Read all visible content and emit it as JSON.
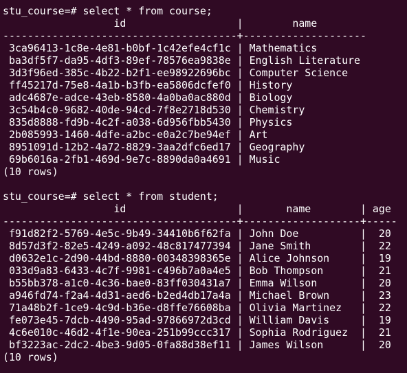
{
  "terminal": {
    "lines": [
      "stu_course=# select * from course;",
      "                  id                  |        name",
      "--------------------------------------+--------------------",
      " 3ca96413-1c8e-4e81-b0bf-1c42efe4cf1c | Mathematics",
      " ba3df5f7-da95-4df3-89ef-78576ea9838e | English Literature",
      " 3d3f96ed-385c-4b22-b2f1-ee98922696bc | Computer Science",
      " ff45217d-75e8-4a1b-b3fb-ea5806dcfef0 | History",
      " adc4687e-adce-43eb-8580-4a0ba0ac880d | Biology",
      " 3c54b4c0-9682-40de-94cd-7f8e2718d530 | Chemistry",
      " 835d8888-fd9b-4c2f-a038-6d956fbb5430 | Physics",
      " 2b085993-1460-4dfe-a2bc-e0a2c7be94ef | Art",
      " 8951091d-12b2-4a72-8829-3aa2dfc6ed17 | Geography",
      " 69b6016a-2fb1-469d-9e7c-8890da0a4691 | Music",
      "(10 rows)",
      "",
      "stu_course=# select * from student;",
      "                  id                  |       name        | age",
      "--------------------------------------+-------------------+-----",
      " f91d82f2-5769-4e5c-9b49-34410b6f62fa | John Doe          |  20",
      " 8d57d3f2-82e5-4249-a092-48c817477394 | Jane Smith        |  22",
      " d0632e1c-2d90-44bd-8880-00348398365e | Alice Johnson     |  19",
      " 033d9a83-6433-4c7f-9981-c496b7a0a4e5 | Bob Thompson      |  21",
      " b55bb378-a1c0-4c36-bae0-83ff030431a7 | Emma Wilson       |  20",
      " a946fd74-f2a4-4d31-aed6-b2ed4db17a4a | Michael Brown     |  23",
      " 71a48b2f-1ce9-4c9d-b36e-d8ffe76608ba | Olivia Martinez   |  22",
      " fe073e45-7dcb-4490-95ad-97866972d3cd | William Davis     |  19",
      " 4c6e010c-46d2-4f1e-90ea-251b99ccc317 | Sophia Rodriguez  |  21",
      " bf3223ac-2dc2-4be3-9d05-0fa88d38ef11 | James Wilson      |  20",
      "(10 rows)"
    ]
  },
  "colors": {
    "background": "#300a24",
    "foreground": "#ffffff"
  }
}
